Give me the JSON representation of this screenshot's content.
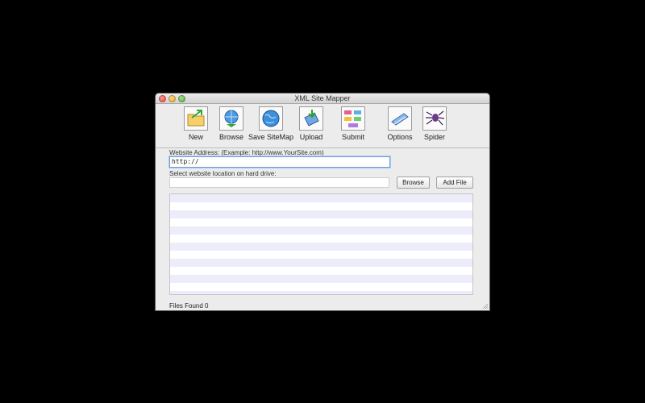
{
  "window": {
    "title": "XML Site Mapper"
  },
  "toolbar": {
    "items": [
      {
        "label": "New",
        "icon": "new-folder-icon"
      },
      {
        "label": "Browse",
        "icon": "browse-globe-icon"
      },
      {
        "label": "Save SiteMap",
        "icon": "globe-icon"
      },
      {
        "label": "Upload",
        "icon": "upload-icon"
      },
      {
        "label": "Submit",
        "icon": "submit-icon"
      },
      {
        "label": "Options",
        "icon": "options-icon"
      },
      {
        "label": "Spider",
        "icon": "spider-icon"
      }
    ]
  },
  "form": {
    "address_label": "Website Address: (Example: http://www.YourSite.com)",
    "address_value": "http://",
    "location_label": "Select website location on hard drive:",
    "location_value": "",
    "browse_button": "Browse",
    "add_file_button": "Add File"
  },
  "status": {
    "files_found": "Files Found 0"
  },
  "colors": {
    "background": "#000000",
    "window": "#ececec",
    "focus_ring": "#6f9fd8",
    "row_stripe": "#ececfa"
  }
}
